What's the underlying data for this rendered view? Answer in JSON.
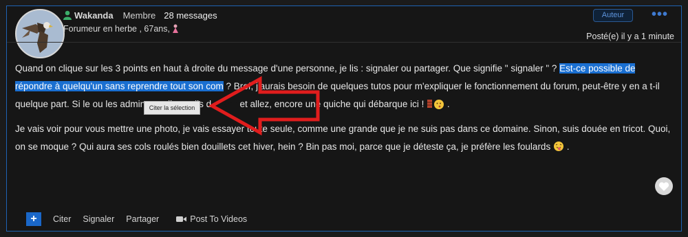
{
  "user": {
    "name": "Wakanda",
    "role": "Membre",
    "messages": "28 messages",
    "subtitle": "Forumeur en herbe , 67ans,"
  },
  "header": {
    "badge": "Auteur",
    "more": "•••",
    "posted": "Posté(e) il y a 1 minute"
  },
  "message": {
    "p1_before": "Quand on clique sur les 3 points en haut à droite du message d'une personne, je lis : signaler ou partager. Que signifie \" signaler \" ? ",
    "p1_highlight": "Est-ce possible de répondre à quelqu'un sans reprendre tout son com",
    "p1_after": " ? Bref, j'aurais besoin de quelques tutos pour m'expliquer le fonctionnement du forum, peut-être y en a t-il quelque part. Si le ou les admins me lisent, ils d",
    "p1_hidden": "evront",
    "p1_end": "et allez, encore une quiche qui débarque ici ! ",
    "p1_tail": " .",
    "p2": "Je vais voir pour vous mettre une photo, je vais essayer toute seule, comme une grande que je ne suis pas dans ce domaine. Sinon, suis douée en tricot. Quoi, on se moque ? Qui aura ses cols roulés bien douillets cet hiver, hein ? Bin pas moi, parce que je déteste ça, je préfère les foulards",
    "p2_tail": " ."
  },
  "tooltip": "Citer la sélection",
  "actions": {
    "plus": "+",
    "quote": "Citer",
    "report": "Signaler",
    "share": "Partager",
    "video": "Post To Videos"
  },
  "colors": {
    "accent": "#1a67c8",
    "highlight": "#1a6fd1",
    "arrow": "#e01d1d"
  }
}
